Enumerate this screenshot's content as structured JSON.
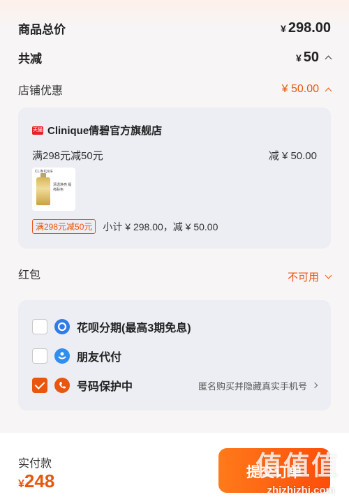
{
  "summary": {
    "goods_total_label": "商品总价",
    "goods_total_currency": "¥",
    "goods_total_value": "298.00",
    "total_discount_label": "共减",
    "total_discount_currency": "¥",
    "total_discount_value": "50",
    "store_discount_label": "店铺优惠",
    "store_discount_value": "¥ 50.00"
  },
  "store_card": {
    "badge": "天猫",
    "store_name": "Clinique倩碧官方旗舰店",
    "promo_text": "满298元减50元",
    "promo_amount": "减 ¥ 50.00",
    "product_brand": "CLINIQUE",
    "product_caption": "清透焕亮 提亮肤色",
    "promo_tag": "满298元减50元",
    "subtotal": "小计 ¥ 298.00，减 ¥ 50.00"
  },
  "red_packet": {
    "label": "红包",
    "status": "不可用"
  },
  "options": [
    {
      "label": "花呗分期(最高3期免息)",
      "checked": false,
      "icon": "huabei-icon",
      "color": "#2f7bea"
    },
    {
      "label": "朋友代付",
      "checked": false,
      "icon": "friend-pay-icon",
      "color": "#2f8ff0"
    },
    {
      "label": "号码保护中",
      "checked": true,
      "icon": "phone-protect-icon",
      "color": "#e8560f",
      "desc": "匿名购买并隐藏真实手机号"
    }
  ],
  "footer": {
    "pay_label": "实付款",
    "pay_currency": "¥",
    "pay_value": "248",
    "submit_label": "提交订单",
    "watermark": "值值值",
    "watermark_url": "zhizhizhi.com"
  },
  "colors": {
    "accent": "#e8560f"
  }
}
